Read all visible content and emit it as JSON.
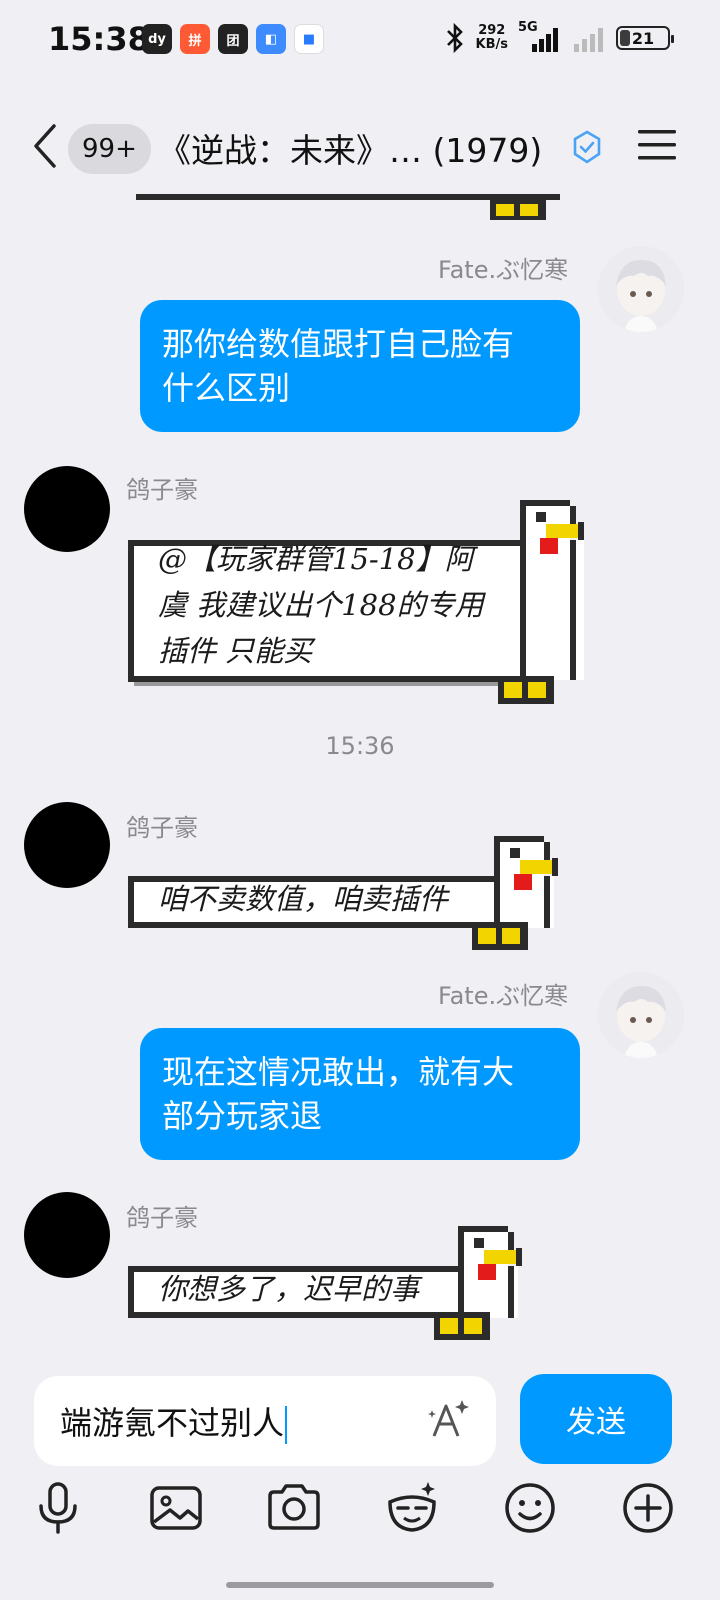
{
  "status_bar": {
    "time": "15:38",
    "net_speed": "292",
    "net_unit": "KB/s",
    "network": "5G",
    "battery": "21"
  },
  "header": {
    "unread_badge": "99+",
    "title": "《逆战：未来》…  (1979)"
  },
  "messages": [
    {
      "sender": "Fate.ぶ忆寒",
      "side": "right",
      "text_line1": "那你给数值跟打自己脸有",
      "text_line2": "什么区别"
    },
    {
      "sender": "鸽子豪",
      "side": "left",
      "text_line1": "@【玩家群管15-18】阿",
      "text_line2": "虞 我建议出个188的专用",
      "text_line3": "插件 只能买"
    },
    {
      "timestamp": "15:36"
    },
    {
      "sender": "鸽子豪",
      "side": "left",
      "text_line1": "咱不卖数值，咱卖插件"
    },
    {
      "sender": "Fate.ぶ忆寒",
      "side": "right",
      "text_line1": "现在这情况敢出，就有大",
      "text_line2": "部分玩家退"
    },
    {
      "sender": "鸽子豪",
      "side": "left",
      "text_line1": "你想多了，迟早的事"
    }
  ],
  "input": {
    "value": "端游氪不过别人",
    "send_label": "发送"
  },
  "colors": {
    "accent": "#0099ff",
    "background": "#f0f0f4"
  }
}
